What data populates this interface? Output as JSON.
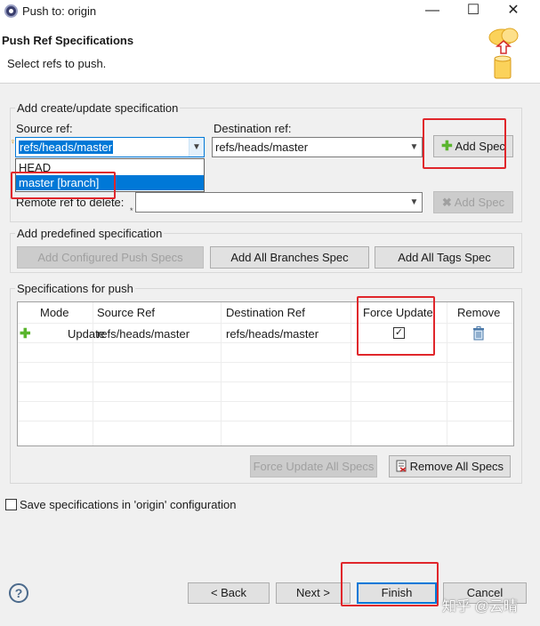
{
  "window": {
    "title": "Push to: origin",
    "minimize": "—",
    "maximize": "☐",
    "close": "✕"
  },
  "header": {
    "title": "Push Ref Specifications",
    "subtitle": "Select refs to push."
  },
  "add_group": {
    "title": "Add create/update specification",
    "source_label": "Source ref:",
    "source_value": "refs/heads/master",
    "dest_label": "Destination ref:",
    "dest_value": "refs/heads/master",
    "add_spec": "Add Spec",
    "dropdown_items": [
      "HEAD",
      "master [branch]"
    ]
  },
  "delete_group": {
    "remote_label": "Remote ref to delete:",
    "remote_value": "",
    "add_spec": "Add Spec"
  },
  "predefined_group": {
    "title": "Add predefined specification",
    "configured": "Add Configured Push Specs",
    "all_branches": "Add All Branches Spec",
    "all_tags": "Add All Tags Spec"
  },
  "specs_group": {
    "title": "Specifications for push",
    "columns": [
      "Mode",
      "Source Ref",
      "Destination Ref",
      "Force Update",
      "Remove"
    ],
    "rows": [
      {
        "mode": "Update",
        "source": "refs/heads/master",
        "dest": "refs/heads/master",
        "force": true
      }
    ],
    "force_update_all": "Force Update All Specs",
    "remove_all": "Remove All Specs"
  },
  "save_option": {
    "label": "Save specifications in 'origin' configuration",
    "checked": false
  },
  "footer": {
    "help": "?",
    "back": "< Back",
    "next": "Next >",
    "finish": "Finish",
    "cancel": "Cancel"
  },
  "watermark": "知乎 @云晴",
  "colors": {
    "accent": "#0078d7",
    "annotation": "#e0262b",
    "add_icon": "#5ab52e"
  }
}
